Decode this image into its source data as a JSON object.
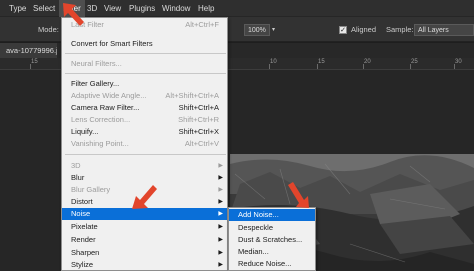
{
  "menubar": {
    "items": [
      {
        "label": "Type"
      },
      {
        "label": "Select"
      },
      {
        "label": "Filter"
      },
      {
        "label": "3D"
      },
      {
        "label": "View"
      },
      {
        "label": "Plugins"
      },
      {
        "label": "Window"
      },
      {
        "label": "Help"
      }
    ]
  },
  "options_bar": {
    "mode_label": "Mode:",
    "zoom_value": "100%",
    "aligned_label": "Aligned",
    "sample_label": "Sample:",
    "sample_value": "All Layers"
  },
  "document_tab": {
    "title": "ava-10779996.jpg"
  },
  "ruler": {
    "labels": [
      "15",
      "10",
      "5",
      "0",
      "5",
      "10",
      "15",
      "20",
      "25",
      "30"
    ]
  },
  "filter_menu": {
    "items": [
      {
        "label": "Last Filter",
        "shortcut": "Alt+Ctrl+F",
        "disabled": true
      },
      {
        "label": "Convert for Smart Filters",
        "disabled": false
      },
      {
        "label": "Neural Filters...",
        "disabled": true
      },
      {
        "label": "Filter Gallery...",
        "disabled": false
      },
      {
        "label": "Adaptive Wide Angle...",
        "shortcut": "Alt+Shift+Ctrl+A",
        "disabled": true
      },
      {
        "label": "Camera Raw Filter...",
        "shortcut": "Shift+Ctrl+A",
        "disabled": false
      },
      {
        "label": "Lens Correction...",
        "shortcut": "Shift+Ctrl+R",
        "disabled": true
      },
      {
        "label": "Liquify...",
        "shortcut": "Shift+Ctrl+X",
        "disabled": false
      },
      {
        "label": "Vanishing Point...",
        "shortcut": "Alt+Ctrl+V",
        "disabled": true
      },
      {
        "label": "3D",
        "disabled": true
      },
      {
        "label": "Blur",
        "disabled": false
      },
      {
        "label": "Blur Gallery",
        "disabled": true
      },
      {
        "label": "Distort",
        "disabled": false
      },
      {
        "label": "Noise",
        "disabled": false
      },
      {
        "label": "Pixelate",
        "disabled": false
      },
      {
        "label": "Render",
        "disabled": false
      },
      {
        "label": "Sharpen",
        "disabled": false
      },
      {
        "label": "Stylize",
        "disabled": false
      }
    ]
  },
  "noise_submenu": {
    "items": [
      {
        "label": "Add Noise..."
      },
      {
        "label": "Despeckle"
      },
      {
        "label": "Dust & Scratches..."
      },
      {
        "label": "Median..."
      },
      {
        "label": "Reduce Noise..."
      }
    ]
  },
  "colors": {
    "highlight": "#0a6fd8",
    "callout_arrow": "#e2452c"
  }
}
